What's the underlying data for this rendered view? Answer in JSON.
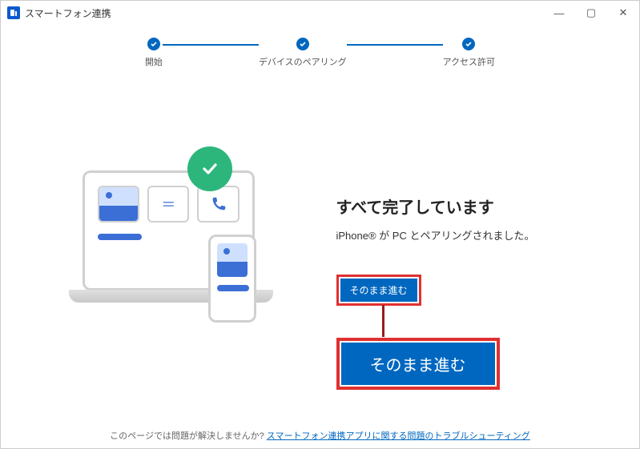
{
  "window": {
    "title": "スマートフォン連携"
  },
  "stepper": {
    "steps": [
      "開始",
      "デバイスのペアリング",
      "アクセス許可"
    ]
  },
  "main": {
    "heading": "すべて完了しています",
    "subtext": "iPhone® が PC とペアリングされました。",
    "continue_small": "そのまま進む",
    "continue_large": "そのまま進む"
  },
  "footer": {
    "prefix": "このページでは問題が解決しませんか? ",
    "link": "スマートフォン連携アプリに関する問題のトラブルシューティング"
  }
}
